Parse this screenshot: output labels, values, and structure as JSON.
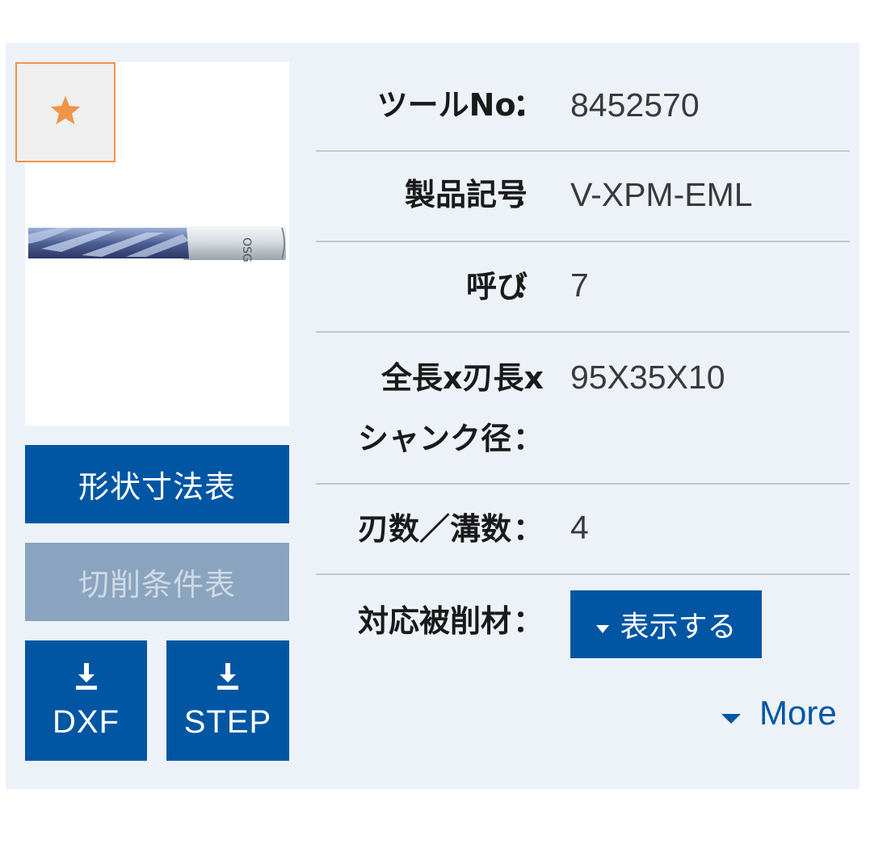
{
  "product": {
    "specs": [
      {
        "label": "ツールNo.",
        "value": "8452570"
      },
      {
        "label": "製品記号",
        "value": "V-XPM-EML"
      },
      {
        "label": "呼び",
        "value": "7"
      },
      {
        "label_line1": "全長x刃長x",
        "label_line2": "シャンク径",
        "value": "95X35X10"
      },
      {
        "label": "刃数／溝数",
        "value": "4"
      },
      {
        "label": "対応被削材"
      }
    ],
    "colon": "：",
    "show_button": "表示する",
    "more_link": "More"
  },
  "actions": {
    "shape_table": "形状寸法表",
    "cutting_table": "切削条件表",
    "download_dxf": "DXF",
    "download_step": "STEP"
  },
  "icons": {
    "favorite": "star-icon",
    "download": "download-icon",
    "caret": "caret-down-icon"
  },
  "colors": {
    "primary": "#0056a3",
    "disabled": "#8aa4bf",
    "star": "#f0944a",
    "panel": "#edf2f9"
  }
}
